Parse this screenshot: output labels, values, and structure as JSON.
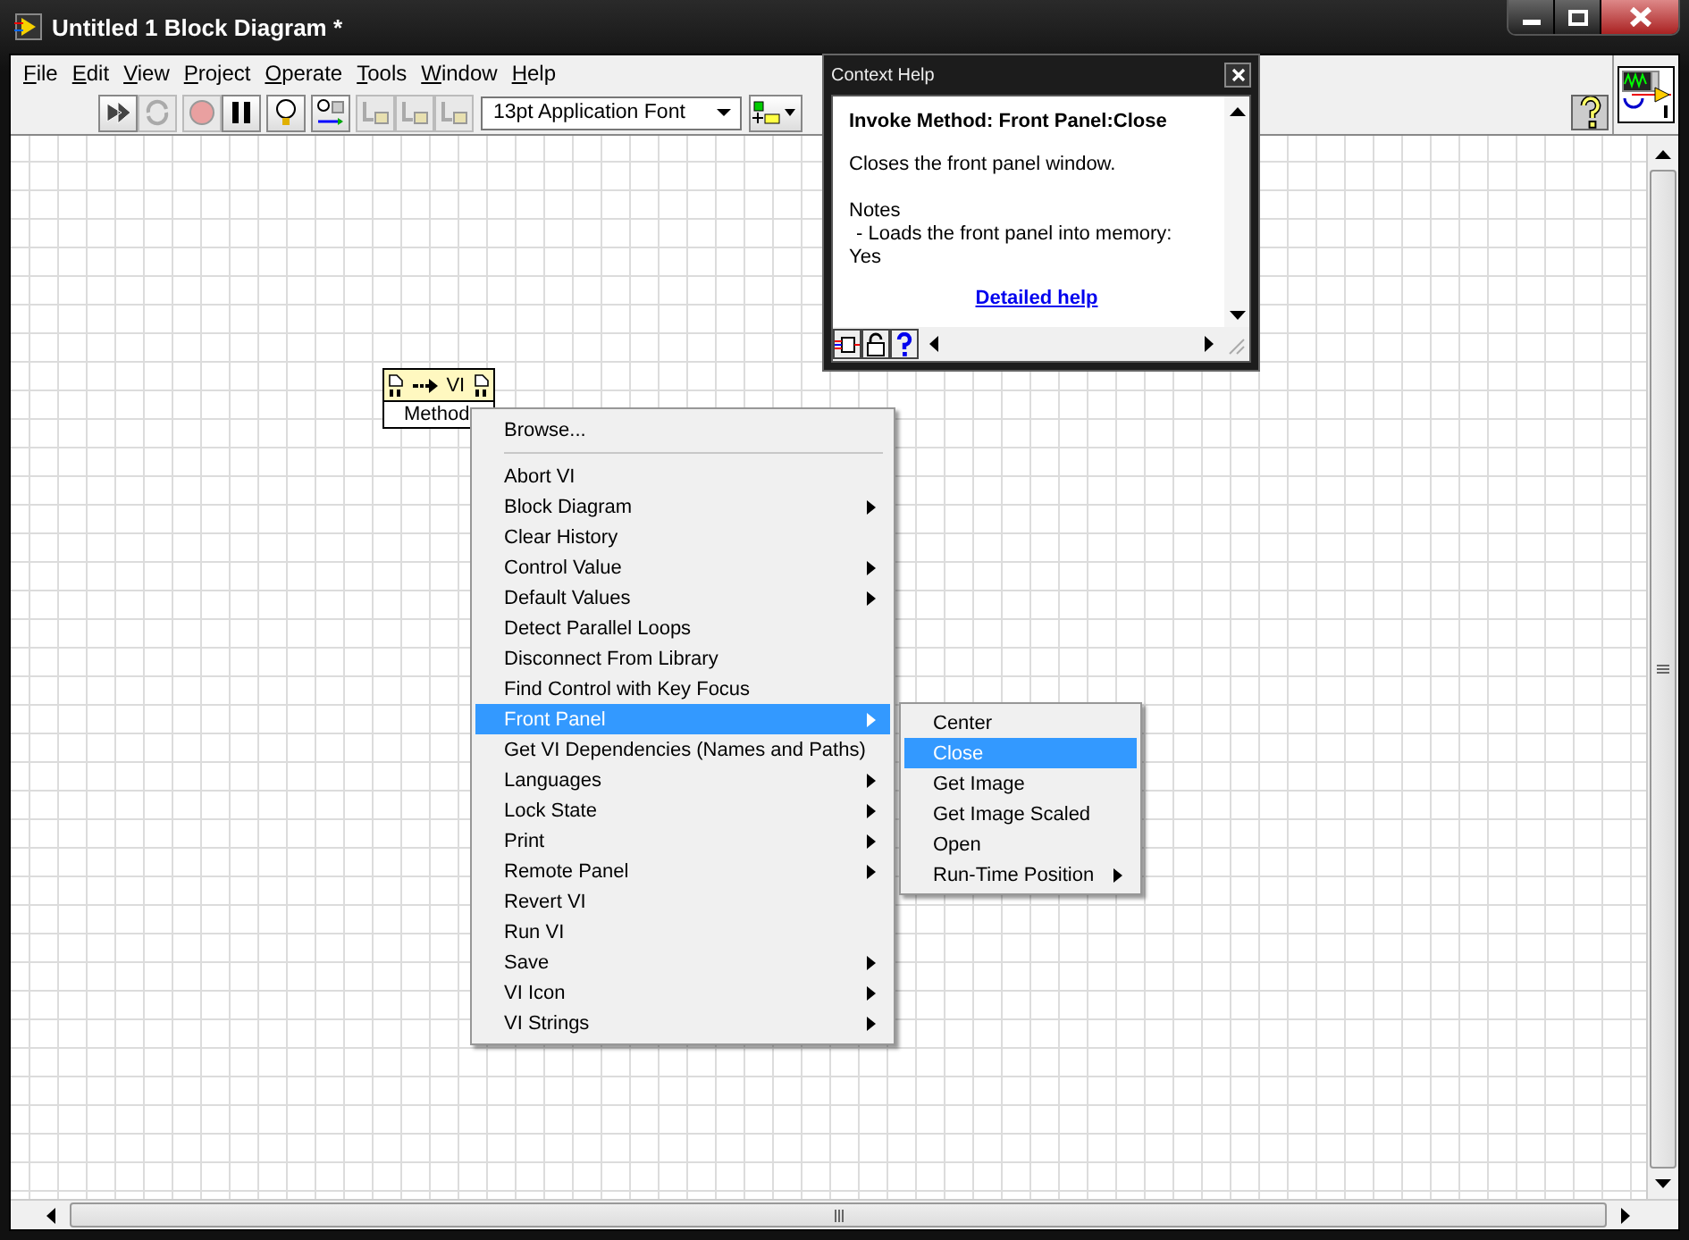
{
  "window": {
    "title": "Untitled 1 Block Diagram *"
  },
  "menu_bar": [
    {
      "label": "File"
    },
    {
      "label": "Edit"
    },
    {
      "label": "View"
    },
    {
      "label": "Project"
    },
    {
      "label": "Operate"
    },
    {
      "label": "Tools"
    },
    {
      "label": "Window"
    },
    {
      "label": "Help"
    }
  ],
  "toolbar": {
    "buttons": [
      {
        "kind": "run",
        "disabled": false
      },
      {
        "kind": "run-continuously",
        "disabled": true
      },
      {
        "kind": "abort",
        "disabled": true
      },
      {
        "kind": "pause",
        "disabled": false
      },
      {
        "kind": "highlight",
        "disabled": false
      },
      {
        "kind": "retain-wire",
        "disabled": false
      },
      {
        "kind": "step-into",
        "disabled": true
      },
      {
        "kind": "step-over",
        "disabled": true
      },
      {
        "kind": "step-out",
        "disabled": true
      }
    ],
    "font_selector": {
      "value": "13pt Application Font"
    }
  },
  "method_node": {
    "object": "VI",
    "method": "Method"
  },
  "context_menu": {
    "items": [
      {
        "kind": "item",
        "label": "Browse...",
        "submenu": false,
        "selected": false
      },
      {
        "kind": "separator"
      },
      {
        "kind": "item",
        "label": "Abort VI",
        "submenu": false,
        "selected": false
      },
      {
        "kind": "item",
        "label": "Block Diagram",
        "submenu": true,
        "selected": false
      },
      {
        "kind": "item",
        "label": "Clear History",
        "submenu": false,
        "selected": false
      },
      {
        "kind": "item",
        "label": "Control Value",
        "submenu": true,
        "selected": false
      },
      {
        "kind": "item",
        "label": "Default Values",
        "submenu": true,
        "selected": false
      },
      {
        "kind": "item",
        "label": "Detect Parallel Loops",
        "submenu": false,
        "selected": false
      },
      {
        "kind": "item",
        "label": "Disconnect From Library",
        "submenu": false,
        "selected": false
      },
      {
        "kind": "item",
        "label": "Find Control with Key Focus",
        "submenu": false,
        "selected": false
      },
      {
        "kind": "item",
        "label": "Front Panel",
        "submenu": true,
        "selected": true
      },
      {
        "kind": "item",
        "label": "Get VI Dependencies (Names and Paths)",
        "submenu": false,
        "selected": false
      },
      {
        "kind": "item",
        "label": "Languages",
        "submenu": true,
        "selected": false
      },
      {
        "kind": "item",
        "label": "Lock State",
        "submenu": true,
        "selected": false
      },
      {
        "kind": "item",
        "label": "Print",
        "submenu": true,
        "selected": false
      },
      {
        "kind": "item",
        "label": "Remote Panel",
        "submenu": true,
        "selected": false
      },
      {
        "kind": "item",
        "label": "Revert VI",
        "submenu": false,
        "selected": false
      },
      {
        "kind": "item",
        "label": "Run VI",
        "submenu": false,
        "selected": false
      },
      {
        "kind": "item",
        "label": "Save",
        "submenu": true,
        "selected": false
      },
      {
        "kind": "item",
        "label": "VI Icon",
        "submenu": true,
        "selected": false
      },
      {
        "kind": "item",
        "label": "VI Strings",
        "submenu": true,
        "selected": false
      }
    ]
  },
  "submenu": {
    "items": [
      {
        "label": "Center",
        "submenu": false,
        "selected": false
      },
      {
        "label": "Close",
        "submenu": false,
        "selected": true
      },
      {
        "label": "Get Image",
        "submenu": false,
        "selected": false
      },
      {
        "label": "Get Image Scaled",
        "submenu": false,
        "selected": false
      },
      {
        "label": "Open",
        "submenu": false,
        "selected": false
      },
      {
        "label": "Run-Time Position",
        "submenu": true,
        "selected": false
      }
    ]
  },
  "context_help": {
    "title": "Context Help",
    "heading": "Invoke Method:  Front Panel:Close",
    "description": "Closes the front panel window.",
    "notes_heading": "Notes",
    "note_lines": [
      "- Loads the front panel into memory:",
      "Yes"
    ],
    "link": "Detailed help"
  }
}
